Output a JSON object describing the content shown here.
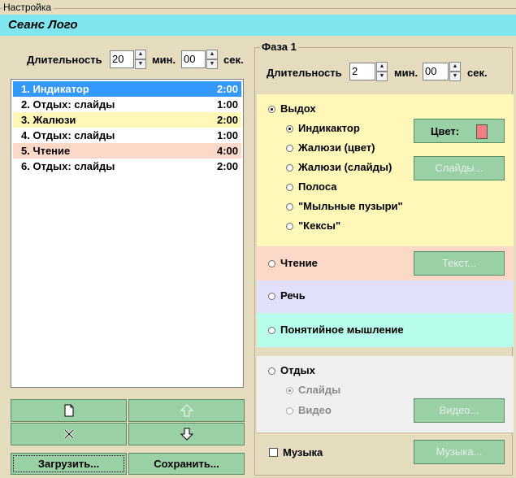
{
  "window_title": "Настройка",
  "session_title": "Сеанс Лого",
  "left": {
    "duration_label": "Длительность",
    "minutes": "20",
    "min_label": "мин.",
    "seconds": "00",
    "sec_label": "сек.",
    "items": [
      {
        "label": "1. Индикатор",
        "duration": "2:00",
        "bg": "#3399ff",
        "fg": "#ffffff"
      },
      {
        "label": "2. Отдых: слайды",
        "duration": "1:00",
        "bg": "#ffffff",
        "fg": "#000000"
      },
      {
        "label": "3. Жалюзи",
        "duration": "2:00",
        "bg": "#fff8b8",
        "fg": "#000000"
      },
      {
        "label": "4. Отдых: слайды",
        "duration": "1:00",
        "bg": "#ffffff",
        "fg": "#000000"
      },
      {
        "label": "5. Чтение",
        "duration": "4:00",
        "bg": "#fcd8c8",
        "fg": "#000000"
      },
      {
        "label": "6. Отдых: слайды",
        "duration": "2:00",
        "bg": "#ffffff",
        "fg": "#000000"
      }
    ],
    "load_label": "Загрузить...",
    "save_label": "Сохранить..."
  },
  "phase": {
    "title": "Фаза 1",
    "duration_label": "Длительность",
    "minutes": "2",
    "min_label": "мин.",
    "seconds": "00",
    "sec_label": "сек.",
    "exhale": {
      "label": "Выдох",
      "options": [
        "Индикактор",
        "Жалюзи (цвет)",
        "Жалюзи (слайды)",
        "Полоса",
        "\"Мыльные пузыри\"",
        "\"Кексы\""
      ],
      "color_label": "Цвет:",
      "color_value": "#f08080",
      "slides_label": "Слайды..."
    },
    "reading": {
      "label": "Чтение",
      "text_label": "Текст..."
    },
    "speech": {
      "label": "Речь"
    },
    "thinking": {
      "label": "Понятийное мышление"
    },
    "rest": {
      "label": "Отдых",
      "slides_label": "Слайды",
      "video_label": "Видео",
      "video_button": "Видео..."
    },
    "music": {
      "label": "Музыка",
      "button": "Музыка..."
    }
  },
  "colors": {
    "exhale_bg": "#fff8b8",
    "reading_bg": "#fcd8c8",
    "speech_bg": "#e0e0fa",
    "thinking_bg": "#b8fcec",
    "rest_bg": "#f0f0f0",
    "button_green": "#9ad0a6"
  }
}
